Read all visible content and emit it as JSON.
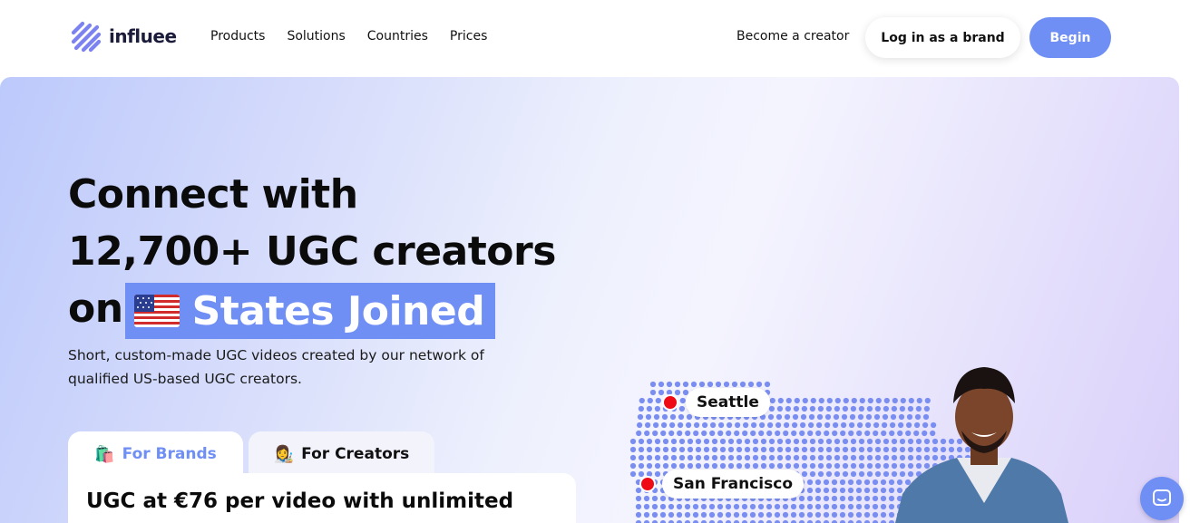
{
  "brand": {
    "name": "influee",
    "logo_icon": "stripes-logo-icon"
  },
  "nav": {
    "items": [
      "Products",
      "Solutions",
      "Countries",
      "Prices"
    ]
  },
  "header": {
    "creator_link": "Become a creator",
    "login_label": "Log in as a brand",
    "begin_label": "Begin"
  },
  "hero": {
    "line1": "Connect with",
    "line2": "12,700+ UGC creators",
    "line3_prefix": "on",
    "highlight": "States Joined",
    "flag_icon": "us-flag-icon",
    "subtitle": "Short, custom-made UGC videos created by our network of qualified US-based UGC creators."
  },
  "tabs": [
    {
      "emoji": "🛍️",
      "label": "For Brands",
      "active": true
    },
    {
      "emoji": "👩‍🎨",
      "label": "For Creators",
      "active": false
    }
  ],
  "card": {
    "title": "UGC at €76 per video with unlimited"
  },
  "map": {
    "cities": [
      "Seattle",
      "San Francisco"
    ]
  },
  "colors": {
    "accent": "#6f8ff5",
    "pin": "#ee0b16",
    "map_dots": "#7a8ef2"
  },
  "chat": {
    "icon": "chat-bubble-icon"
  }
}
